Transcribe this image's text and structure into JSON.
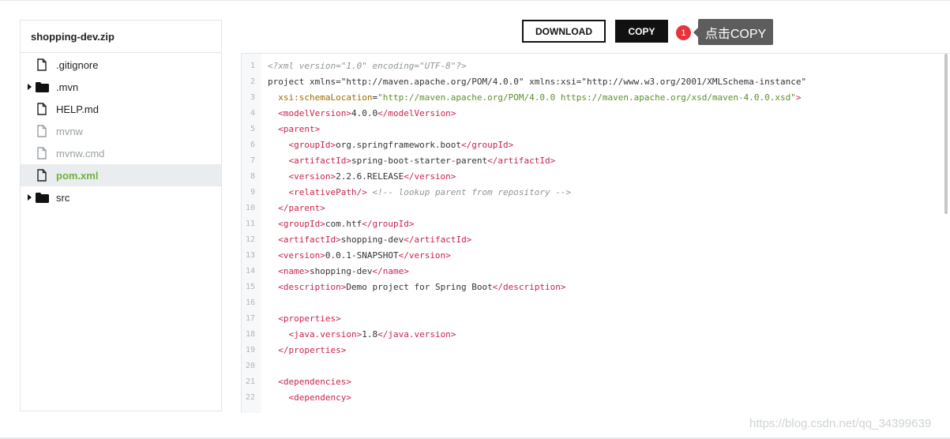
{
  "project": {
    "zip_name": "shopping-dev.zip"
  },
  "files": [
    {
      "name": ".gitignore",
      "type": "file",
      "state": "normal"
    },
    {
      "name": ".mvn",
      "type": "folder",
      "state": "normal"
    },
    {
      "name": "HELP.md",
      "type": "file",
      "state": "normal"
    },
    {
      "name": "mvnw",
      "type": "file",
      "state": "muted"
    },
    {
      "name": "mvnw.cmd",
      "type": "file",
      "state": "muted"
    },
    {
      "name": "pom.xml",
      "type": "file",
      "state": "selected"
    },
    {
      "name": "src",
      "type": "folder",
      "state": "normal"
    }
  ],
  "toolbar": {
    "download_label": "DOWNLOAD",
    "copy_label": "COPY",
    "badge_number": "1",
    "tooltip_text": "点击COPY"
  },
  "colors": {
    "accent_green": "#6db33f",
    "badge_red": "#e8323c",
    "tag_color": "#c7254e",
    "string_color": "#5b8f2a"
  },
  "code": {
    "line_numbers": [
      "1",
      "2",
      "3",
      "4",
      "5",
      "6",
      "7",
      "8",
      "9",
      "10",
      "11",
      "12",
      "13",
      "14",
      "15",
      "16",
      "17",
      "18",
      "19",
      "20",
      "21",
      "22"
    ],
    "lines": [
      "<?xml version=\"1.0\" encoding=\"UTF-8\"?>",
      "<project xmlns=\"http://maven.apache.org/POM/4.0.0\" xmlns:xsi=\"http://www.w3.org/2001/XMLSchema-instance\"",
      "  xsi:schemaLocation=\"http://maven.apache.org/POM/4.0.0 https://maven.apache.org/xsd/maven-4.0.0.xsd\">",
      "  <modelVersion>4.0.0</modelVersion>",
      "  <parent>",
      "    <groupId>org.springframework.boot</groupId>",
      "    <artifactId>spring-boot-starter-parent</artifactId>",
      "    <version>2.2.6.RELEASE</version>",
      "    <relativePath/> <!-- lookup parent from repository -->",
      "  </parent>",
      "  <groupId>com.htf</groupId>",
      "  <artifactId>shopping-dev</artifactId>",
      "  <version>0.0.1-SNAPSHOT</version>",
      "  <name>shopping-dev</name>",
      "  <description>Demo project for Spring Boot</description>",
      "",
      "  <properties>",
      "    <java.version>1.8</java.version>",
      "  </properties>",
      "",
      "  <dependencies>",
      "    <dependency>"
    ]
  },
  "watermark": "https://blog.csdn.net/qq_34399639"
}
